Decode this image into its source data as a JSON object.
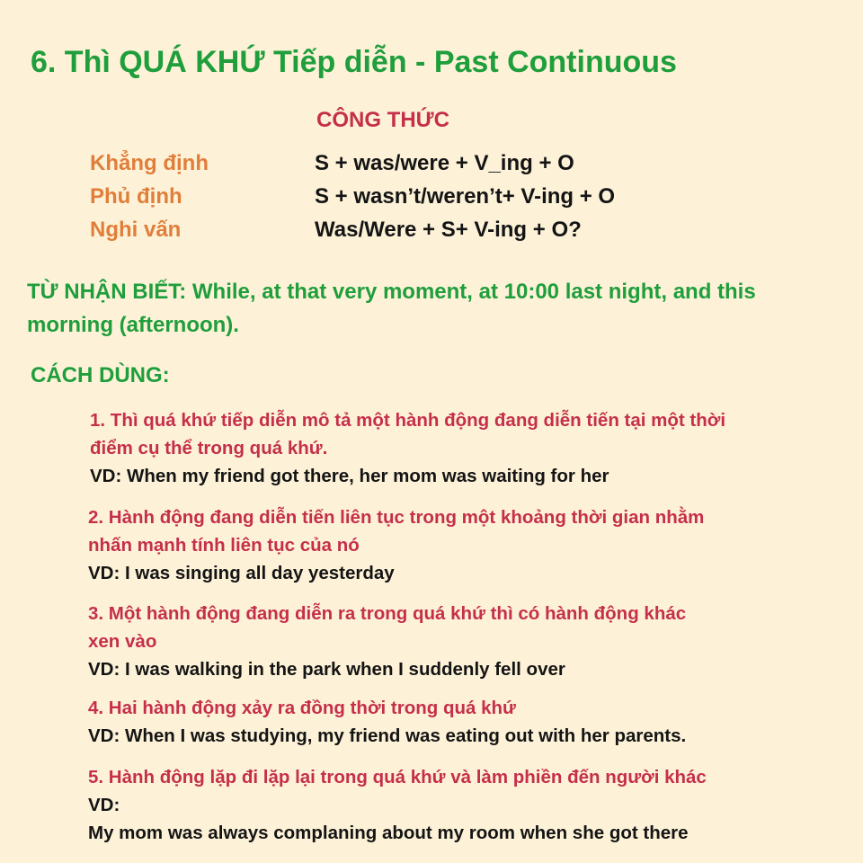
{
  "title": "6. Thì QUÁ KHỨ Tiếp diễn - Past Continuous",
  "formula_heading": "CÔNG THỨC",
  "formulas": [
    {
      "label": "Khẳng định",
      "value": "S + was/were + V_ing + O"
    },
    {
      "label": "Phủ định",
      "value": "S + wasn’t/weren’t+ V-ing + O"
    },
    {
      "label": "Nghi vấn",
      "value": "Was/Were + S+ V-ing + O?"
    }
  ],
  "signals": "TỪ NHẬN BIẾT: While, at that very moment, at 10:00 last night, and this morning (afternoon).",
  "usage_heading": "CÁCH DÙNG:",
  "usages": [
    {
      "desc": [
        "1. Thì quá khứ tiếp diễn mô tả một hành động đang diễn tiến tại một thời",
        "điểm cụ thể trong quá khứ."
      ],
      "example": [
        "VD: When my friend got there, her mom was waiting for her"
      ]
    },
    {
      "desc": [
        "2. Hành động đang diễn tiến liên tục trong một khoảng thời gian nhằm",
        "nhấn mạnh tính liên tục của nó"
      ],
      "example": [
        "VD:  I was singing all day yesterday"
      ]
    },
    {
      "desc": [
        "3. Một hành động đang diễn ra trong quá khứ thì có hành động khác",
        "xen vào"
      ],
      "example": [
        "VD:  I was walking in the park when I suddenly fell over"
      ]
    },
    {
      "desc": [
        "4. Hai hành động xảy ra đồng thời trong quá khứ"
      ],
      "example": [
        "VD: When I was studying, my friend was eating out with her parents."
      ]
    },
    {
      "desc": [
        "5. Hành động lặp đi lặp lại trong quá khứ và làm phiền đến người khác"
      ],
      "example": [
        "VD:",
        "My mom was always complaning about my room when she got there"
      ]
    }
  ]
}
